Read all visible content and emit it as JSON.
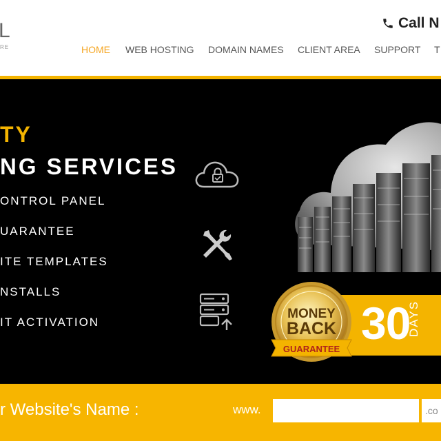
{
  "header": {
    "logo_text": "L",
    "logo_tagline": "RE",
    "call_text": "Call N"
  },
  "nav": [
    {
      "label": "HOME",
      "active": true
    },
    {
      "label": "WEB HOSTING",
      "active": false
    },
    {
      "label": "DOMAIN NAMES",
      "active": false
    },
    {
      "label": "CLIENT AREA",
      "active": false
    },
    {
      "label": "SUPPORT",
      "active": false
    },
    {
      "label": "T",
      "active": false
    }
  ],
  "hero": {
    "headline_1": "TY",
    "headline_2": "NG SERVICES",
    "features": [
      "ONTROL PANEL",
      "UARANTEE",
      "ITE TEMPLATES",
      "NSTALLS",
      "IT ACTIVATION"
    ],
    "icons": [
      "cloud-lock-icon",
      "tools-icon",
      "server-upload-icon"
    ],
    "seal": {
      "line1": "MONEY",
      "line2": "BACK",
      "ribbon": "GUARANTEE"
    },
    "days_number": "30",
    "days_label": "DAYS"
  },
  "domain": {
    "label": "r Website's Name :",
    "prefix": "www.",
    "input_value": "",
    "tld": ".co"
  },
  "colors": {
    "accent": "#f4b400",
    "hero_bg": "#000000"
  }
}
